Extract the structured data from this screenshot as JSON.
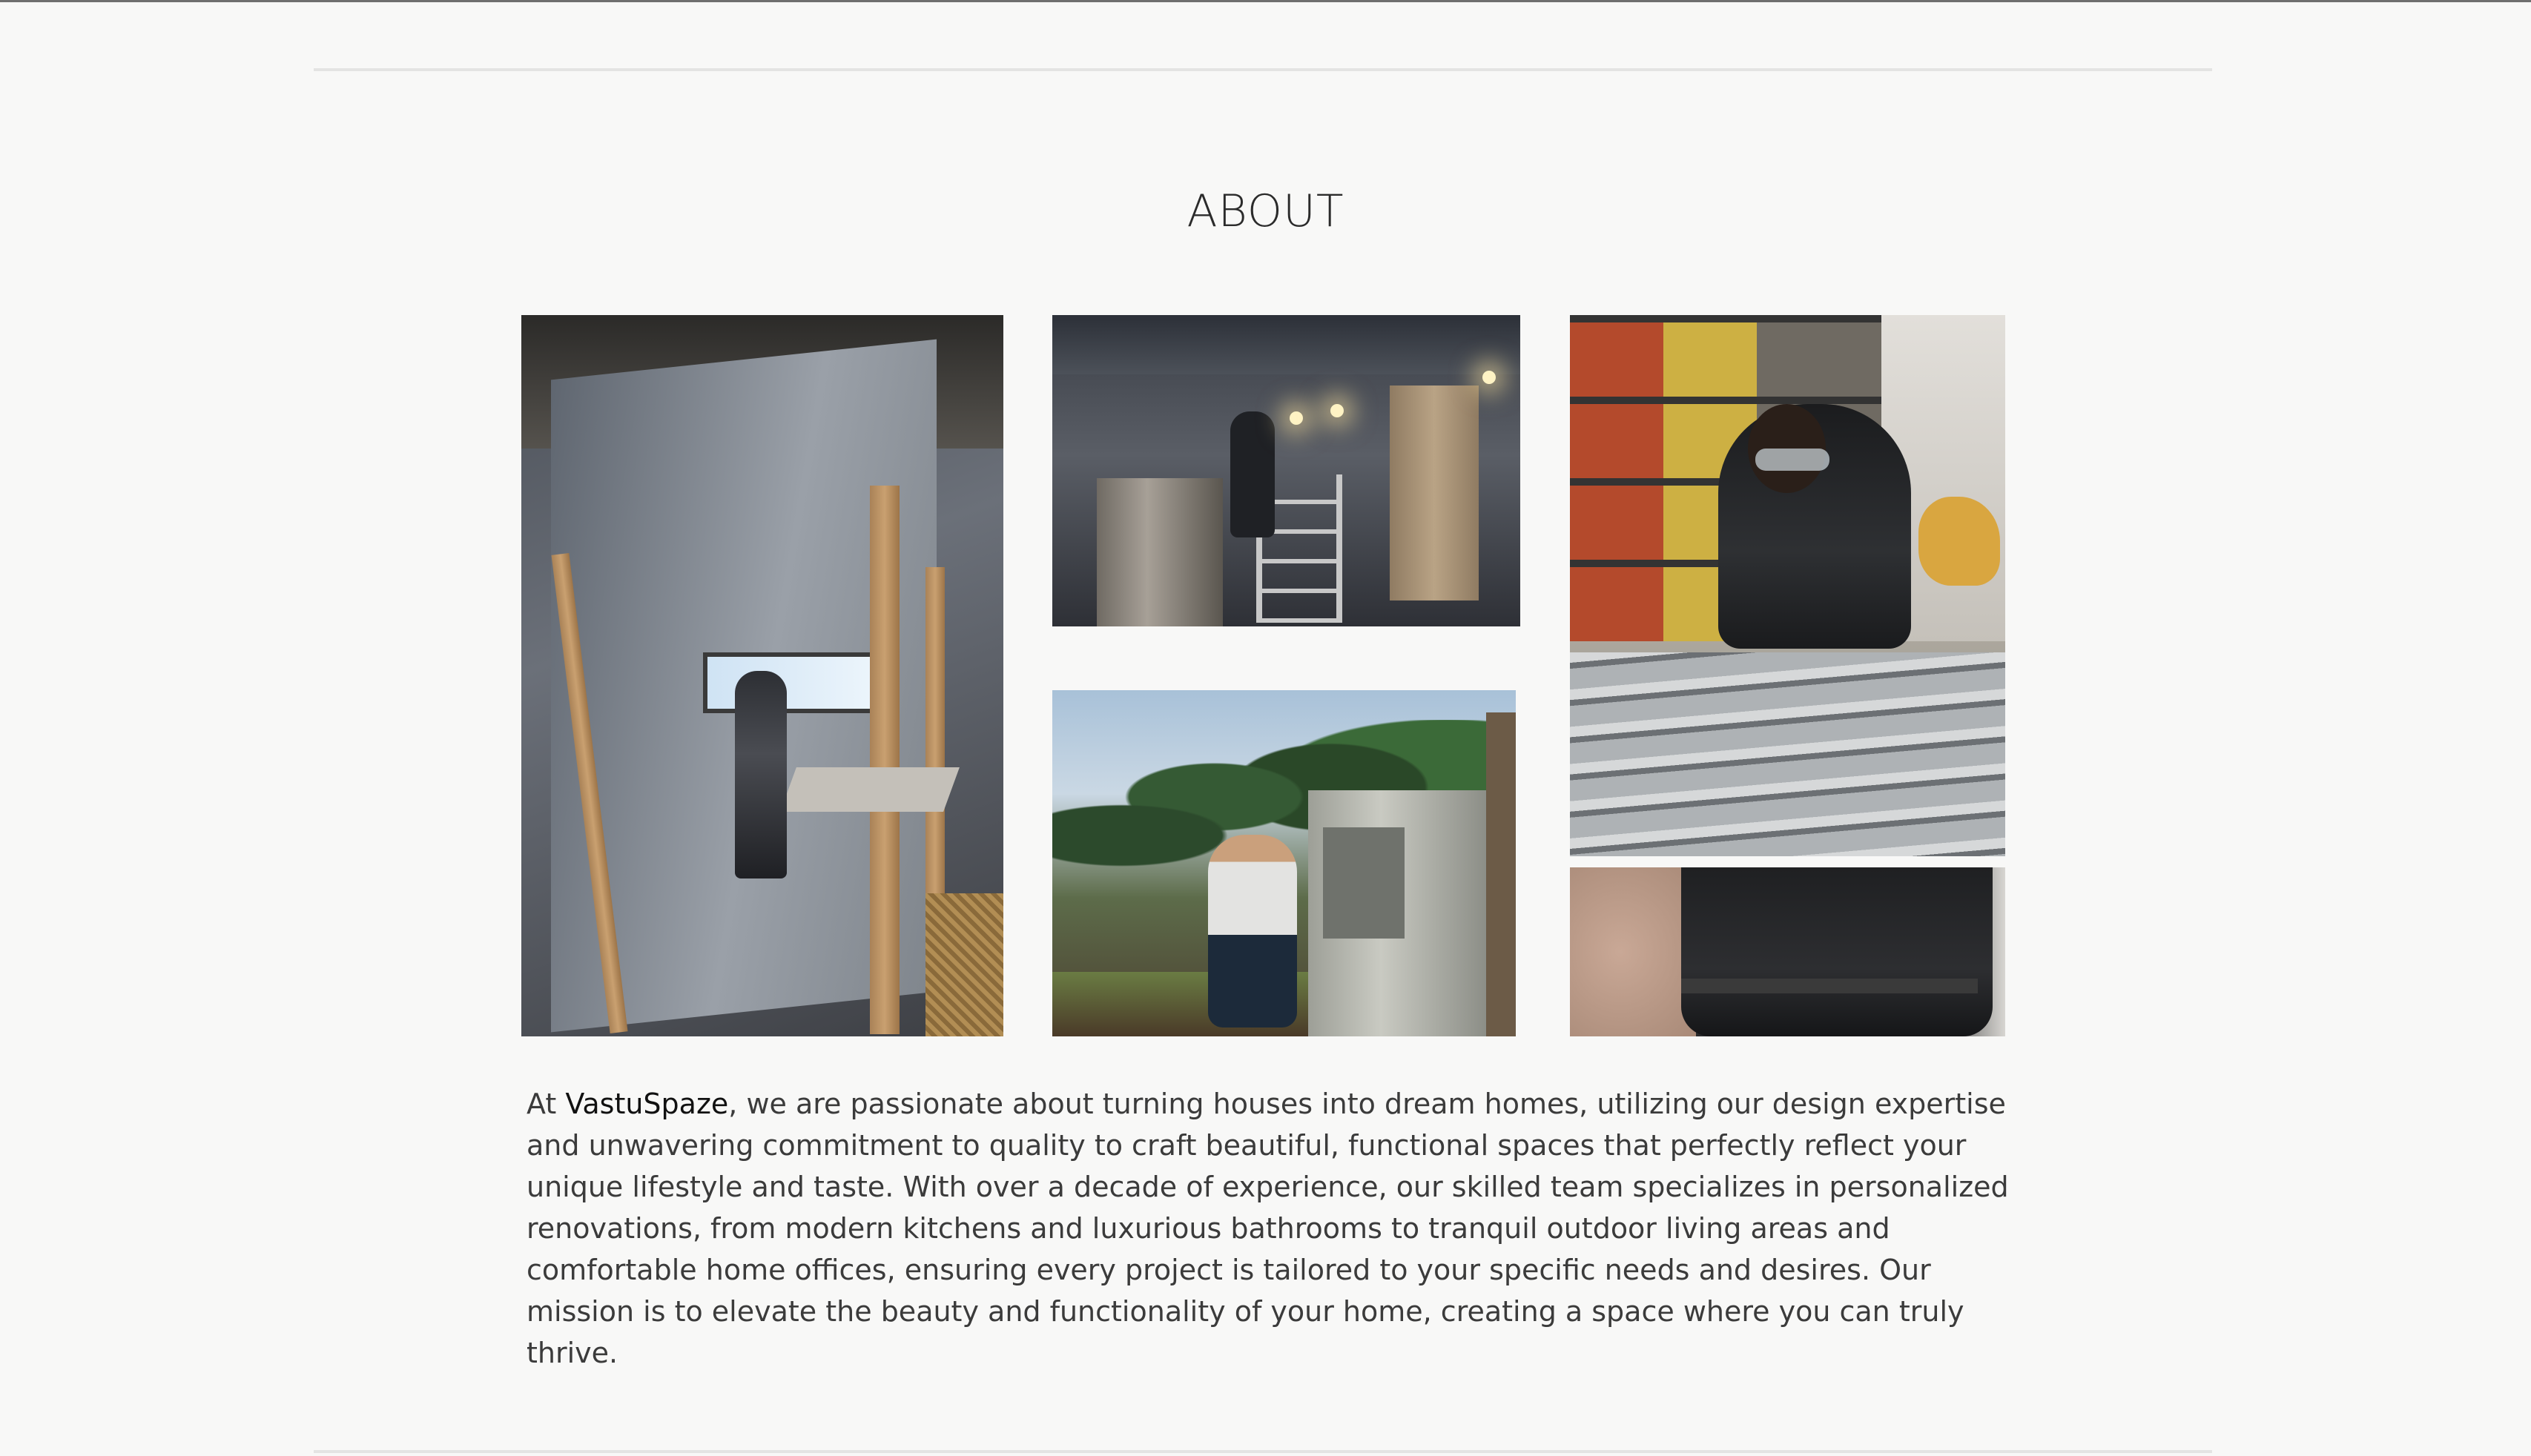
{
  "section": {
    "title": "ABOUT"
  },
  "about": {
    "prefix": "At ",
    "brand": "VastuSpaze",
    "body": ", we are passionate about turning houses into dream homes, utilizing our design expertise and unwavering commitment to quality to craft beautiful, functional spaces that perfectly reflect your unique lifestyle and taste. With over a decade of experience, our skilled team specializes in personalized renovations, from modern kitchens and luxurious bathrooms to tranquil outdoor living areas and comfortable home offices, ensuring every project is tailored to your specific needs and desires. Our mission is to elevate the beauty and functionality of your home, creating a space where you can truly thrive."
  },
  "gallery": {
    "photos": [
      "worker installing drywall in framed interior",
      "worker on ladder in dim room with ceiling lights",
      "worker with safety goggles measuring metal frame",
      "woman working on outdoor electrical cabinet",
      "close-up of worker torso"
    ]
  },
  "colors": {
    "background": "#f8f8f7",
    "text": "#3b3b3b",
    "divider": "#e4e4e3"
  }
}
